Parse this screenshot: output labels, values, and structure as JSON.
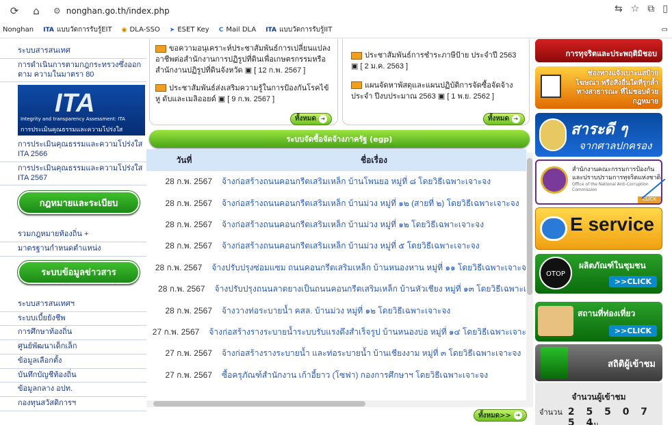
{
  "browser": {
    "url": "nonghan.go.th/index.php",
    "bookmarks": [
      "Nonghan",
      "แบบวัดการรับรู้EIT",
      "DLA-SSO",
      "ESET Key",
      "Mail DLA",
      "แบบวัดการรับรู้IIT"
    ]
  },
  "left": {
    "links_top": [
      "ระบบสารสนเทศ",
      "การดำเนินการตามกฎกระทรวงซึ่งออก ตาม ความในมาตรา 80"
    ],
    "ita_banner": {
      "logo": "ITA",
      "line1": "Integrity and transparency Assessment: ITA",
      "line2": "การประเมินคุณธรรมและความโปร่งใส"
    },
    "links_ita": [
      "การประเมินคุณธรรมและความโปร่งใส ITA 2566",
      "การประเมินคุณธรรมและความโปร่งใส ITA 2567"
    ],
    "law_header": "กฎหมายและระเบียบ",
    "law_links": [
      "รวมกฎหมายท้องถิ่น +",
      "มาตรฐานกำหนดตำแหน่ง"
    ],
    "info_header": "ระบบข้อมูลข่าวสาร",
    "info_links": [
      "ระบบสารสนเทศฯ",
      "ระบบเบี้ยยังชีพ",
      "การศึกษาท้องถิ่น",
      "ศูนย์พัฒนาเด็กเล็ก",
      "ข้อมูลเลือกตั้ง",
      "บันทึกบัญชีท้องถิ่น",
      "ข้อมูลกลาง อปท.",
      "กองทุนสวัสดิการฯ"
    ]
  },
  "news": {
    "left_items": [
      {
        "text": "ขอความอนุเคราะห์ประชาสัมพันธ์การเปลี่ยนแปลง อาชีพต่อสำนักงานการปฏิรูปที่ดินเพื่อเกษตรกรรมหรือ สำนักงานปฏิรูปที่ดินจังหวัด",
        "date": "[ 12 ก.พ. 2567 ]"
      },
      {
        "text": "ประชาสัมพันธ์ส่งเสริมความรู้ในการป้องกันโรคไข้หู ดับและเมลิออยด์",
        "date": "[ 9 ก.พ. 2567 ]"
      }
    ],
    "right_items": [
      {
        "text": "ประชาสัมพันธ์การชำระภาษีป้าย ประจำปี 2563",
        "date": "[ 2 ม.ค. 2563 ]"
      },
      {
        "text": "แผนจัดหาพัสดุและแผนปฏิบัติการจัดซื้อจัดจ้าง ประจำ ปีงบประมาณ 2563",
        "date": "[ 1 พ.ย. 2562 ]"
      }
    ],
    "all_label": "ทั้งหมด"
  },
  "egp": {
    "title": "ระบบจัดซื้อจัดจ้างภาครัฐ (egp)",
    "col_date": "วันที่",
    "col_title": "ชื่อเรื่อง",
    "rows": [
      {
        "date": "28 ก.พ. 2567",
        "title": "จ้างก่อสร้างถนนคอนกรีตเสริมเหล็ก บ้านโพนยอ หมู่ที่ ๘ โดยวิธีเฉพาะเจาะจง"
      },
      {
        "date": "28 ก.พ. 2567",
        "title": "จ้างก่อสร้างถนนคอนกรีตเสริมเหล็ก บ้านม่วง หมู่ที่ ๑๒ (สายที่ ๒) โดยวิธีเฉพาะเจาะจง"
      },
      {
        "date": "28 ก.พ. 2567",
        "title": "จ้างก่อสร้างถนนคอนกรีตเสริมเหล็ก บ้านม่วง หมู่ที่ ๑๒ โดยวิธีเฉพาะเจาะจง"
      },
      {
        "date": "28 ก.พ. 2567",
        "title": "จ้างก่อสร้างถนนคอนกรีตเสริมเหล็ก บ้านม่วง หมู่ที่ ๕ โดยวิธีเฉพาะเจาะจง"
      },
      {
        "date": "28 ก.พ. 2567",
        "title": "จ้างปรับปรุงซ่อมแซม ถนนคอนกรีตเสริมเหล็ก บ้านหนองหาน หมู่ที่ ๑๑ โดยวิธีเฉพาะเจาะจ"
      },
      {
        "date": "28 ก.พ. 2567",
        "title": "จ้างปรับปรุงถนนลาดยางเป็นถนนคอนกรีตเสริมเหล็ก บ้านหัวเชียง หมู่ที่ ๑๓ โดยวิธีเฉพาะเ"
      },
      {
        "date": "28 ก.พ. 2567",
        "title": "จ้างวางท่อระบายน้ำ คสล. บ้านม่วง หมู่ที่ ๑๒ โดยวิธีเฉพาะเจาะจง"
      },
      {
        "date": "27 ก.พ. 2567",
        "title": "จ้างก่อสร้างรางระบายน้ำระบบรับแรงดึงสำเร็จรูป บ้านหนองบ่อ หมู่ที่ ๑๔ โดยวิธีเฉพาะเจาะ"
      },
      {
        "date": "27 ก.พ. 2567",
        "title": "จ้างก่อสร้างรางระบายน้ำ และท่อระบายน้ำ บ้านเชียงงาม หมู่ที่ ๓ โดยวิธีเฉพาะเจาะจง"
      },
      {
        "date": "27 ก.พ. 2567",
        "title": "ซื้อครุภัณฑ์สำนักงาน เก้าอี้ยาว (โซฟา) กองการศึกษาฯ โดยวิธีเฉพาะเจาะจง"
      }
    ],
    "all_label": "ทั้งหมด>>"
  },
  "right": {
    "b1": "การทุจริตและประพฤติมิชอบ",
    "b2": "ช่องทางแจ้งเบาะแสป้ายโฆษณา หรือสิ่งอื่นใดที่รุกล้ำทางสาธารณะ ที่ไม่ชอบด้วยกฎหมาย",
    "b3_1": "สาระดี ๆ",
    "b3_2": "จากศาลปกครอง",
    "b4": "สำนักงานคณะกรรมการป้องกัน และปราบปรามการทุจริตแห่งชาติ",
    "b4_sub": "Office of the National Anti-Corruption Commission",
    "b4_click": "CLICK",
    "b5": "E service",
    "b6_logo": "OTOP",
    "b6": "ผลิตภัณฑ์ในชุมชน",
    "b6_click": ">>CLICK",
    "b7": "สถานที่ท่องเที่ยว",
    "b7_click": ">>CLICK",
    "b8": "สถิติผู้เข้าชม",
    "counter_title": "จำนวนผู้เข้าชม",
    "counter_prefix": "จำนวน",
    "counter_digits": "2 5 5 0 7 5 4",
    "counter_unit": "คน"
  }
}
